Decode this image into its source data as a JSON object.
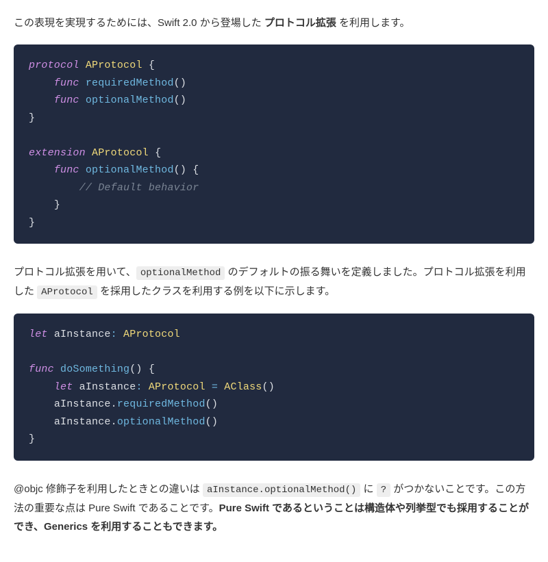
{
  "para1": {
    "t1": "この表現を実現するためには、Swift 2.0 から登場した ",
    "b1": "プロトコル拡張",
    "t2": " を利用します。"
  },
  "code1": {
    "l1_kw1": "protocol",
    "l1_type": "AProtocol",
    "l1_brace": "{",
    "l2_kw": "func",
    "l2_fn": "requiredMethod",
    "l2_p": "()",
    "l3_kw": "func",
    "l3_fn": "optionalMethod",
    "l3_p": "()",
    "l4_brace": "}",
    "l6_kw1": "extension",
    "l6_type": "AProtocol",
    "l6_brace": "{",
    "l7_kw": "func",
    "l7_fn": "optionalMethod",
    "l7_p": "()",
    "l7_brace": "{",
    "l8_cmt": "// Default behavior",
    "l9_brace": "}",
    "l10_brace": "}"
  },
  "para2": {
    "t1": "プロトコル拡張を用いて、",
    "c1": "optionalMethod",
    "t2": " のデフォルトの振る舞いを定義しました。プロトコル拡張を利用した ",
    "c2": "AProtocol",
    "t3": " を採用したクラスを利用する例を以下に示します。"
  },
  "code2": {
    "l1_kw": "let",
    "l1_var": "aInstance",
    "l1_colon": ":",
    "l1_type": "AProtocol",
    "l3_kw": "func",
    "l3_fn": "doSomething",
    "l3_p": "()",
    "l3_brace": "{",
    "l4_kw": "let",
    "l4_var": "aInstance",
    "l4_colon": ":",
    "l4_type1": "AProtocol",
    "l4_eq": "=",
    "l4_type2": "AClass",
    "l4_p": "()",
    "l5_stmt": "aInstance",
    "l5_dot": ".",
    "l5_fn": "requiredMethod",
    "l5_p": "()",
    "l6_stmt": "aInstance",
    "l6_dot": ".",
    "l6_fn": "optionalMethod",
    "l6_p": "()",
    "l7_brace": "}"
  },
  "para3": {
    "t1": "@objc 修飾子を利用したときとの違いは ",
    "c1": "aInstance.optionalMethod()",
    "t2": " に ",
    "c2": "?",
    "t3": " がつかないことです。この方法の重要な点は Pure Swift であることです。",
    "b1": "Pure Swift であるということは構造体や列挙型でも採用することができ、Generics を利用することもできます。"
  }
}
